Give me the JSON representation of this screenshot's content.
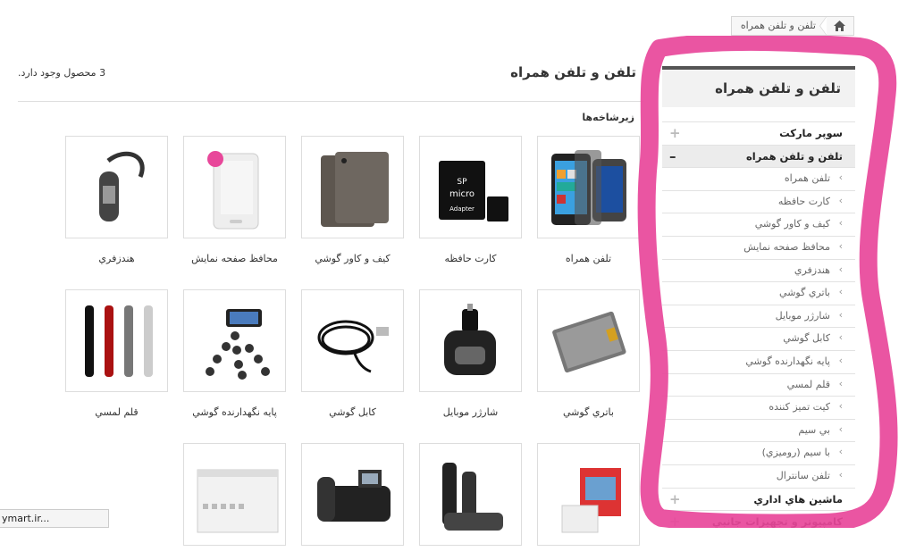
{
  "breadcrumb": {
    "current": "تلفن و تلفن همراه",
    "home_icon": "home-icon"
  },
  "sidebar": {
    "title": "تلفن و تلفن همراه",
    "rows": [
      {
        "label": "سوپر مارکت",
        "type": "cat",
        "toggle": "+"
      },
      {
        "label": "تلفن و تلفن همراه",
        "type": "cat-open",
        "toggle": "–"
      },
      {
        "label": "تلفن همراه",
        "type": "sub"
      },
      {
        "label": "کارت حافظه",
        "type": "sub"
      },
      {
        "label": "کیف و کاور گوشي",
        "type": "sub"
      },
      {
        "label": "محافظ صفحه نمايش",
        "type": "sub"
      },
      {
        "label": "هندزفري",
        "type": "sub"
      },
      {
        "label": "باتري گوشي",
        "type": "sub"
      },
      {
        "label": "شارژر موبايل",
        "type": "sub"
      },
      {
        "label": "کابل گوشي",
        "type": "sub"
      },
      {
        "label": "پايه نگهدارنده گوشي",
        "type": "sub"
      },
      {
        "label": "قلم لمسي",
        "type": "sub"
      },
      {
        "label": "کيت تميز کننده",
        "type": "sub"
      },
      {
        "label": "بي سيم",
        "type": "sub"
      },
      {
        "label": "با سيم (روميزي)",
        "type": "sub"
      },
      {
        "label": "تلفن سانترال",
        "type": "sub"
      },
      {
        "label": "ماشين هاي اداري",
        "type": "cat",
        "toggle": "+"
      },
      {
        "label": "کامپيوتر و تجهيزات جانبي",
        "type": "cat",
        "toggle": "+"
      }
    ]
  },
  "main": {
    "title": "تلفن و تلفن همراه",
    "count_text": "3 محصول وجود دارد.",
    "subcategories_heading": "زيرشاخه‌ها"
  },
  "products": [
    {
      "name": "تلفن همراه",
      "icon": "smartphones-image"
    },
    {
      "name": "کارت حافظه",
      "icon": "memory-card-image"
    },
    {
      "name": "کيف و کاور گوشي",
      "icon": "phone-case-image"
    },
    {
      "name": "محافظ صفحه نمايش",
      "icon": "screen-protector-image"
    },
    {
      "name": "هندزفري",
      "icon": "bluetooth-headset-image"
    },
    {
      "name": "باتري گوشي",
      "icon": "phone-battery-image"
    },
    {
      "name": "شارژر موبايل",
      "icon": "car-charger-image"
    },
    {
      "name": "کابل گوشي",
      "icon": "usb-cable-image"
    },
    {
      "name": "پايه نگهدارنده گوشي",
      "icon": "tripod-holder-image"
    },
    {
      "name": "قلم لمسي",
      "icon": "stylus-pens-image"
    },
    {
      "name": "",
      "icon": "cleaning-kit-image"
    },
    {
      "name": "",
      "icon": "cordless-phones-image"
    },
    {
      "name": "",
      "icon": "desk-phone-image"
    },
    {
      "name": "",
      "icon": "pbx-system-image"
    }
  ],
  "statusbar": {
    "text": "ymart.ir..."
  },
  "colors": {
    "scribble": "#e8479a",
    "accent_border": "#555555"
  }
}
